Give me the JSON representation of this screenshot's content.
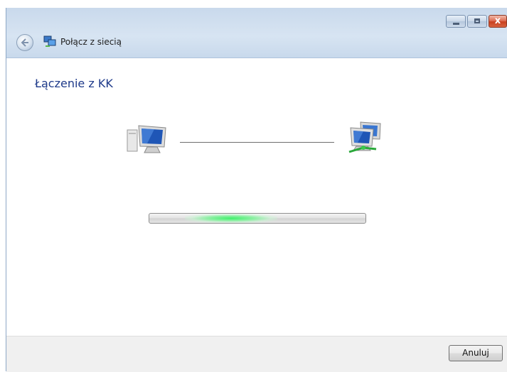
{
  "window": {
    "title": "Połącz z siecią",
    "controls": {
      "close_glyph": "x"
    }
  },
  "main": {
    "heading": "Łączenie z KK",
    "icons": [
      "computer-icon",
      "network-icon"
    ],
    "progress": {
      "state": "indeterminate"
    }
  },
  "footer": {
    "cancel_label": "Anuluj"
  }
}
